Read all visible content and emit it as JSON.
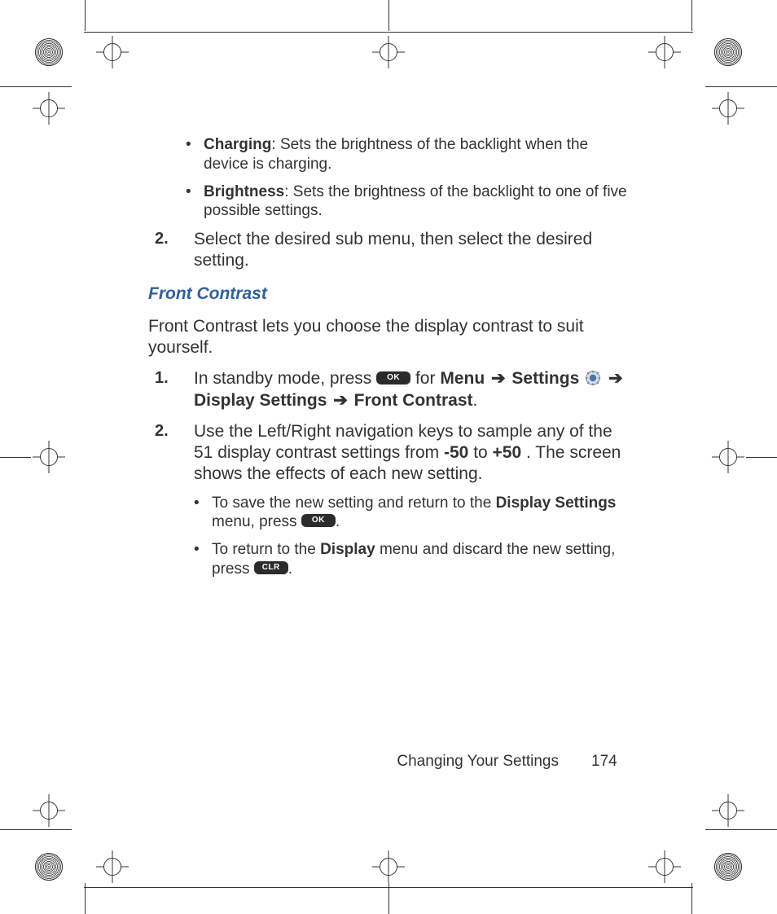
{
  "bullets_top": [
    {
      "term": "Charging",
      "desc": ": Sets the brightness of the backlight when the device is charging."
    },
    {
      "term": "Brightness",
      "desc": ": Sets the brightness of the backlight to one of five possible settings."
    }
  ],
  "step_top": {
    "num": "2.",
    "text": "Select the desired sub menu, then select the desired setting."
  },
  "heading": "Front Contrast",
  "intro": "Front Contrast lets you choose the display contrast to suit yourself.",
  "step1": {
    "num": "1.",
    "lead": "In standby mode, press ",
    "for": " for ",
    "menu": "Menu",
    "arrow": " ➔ ",
    "settings": "Settings",
    "arrow2": " ➔ ",
    "display_settings": "Display Settings",
    "arrow3": " ➔ ",
    "front_contrast": "Front Contrast",
    "period": "."
  },
  "step2": {
    "num": "2.",
    "pre": "Use the Left/Right navigation keys to sample any of the 51 display contrast settings from ",
    "min": "-50",
    "mid": " to ",
    "max": "+50",
    "post": ". The screen shows the effects of each new setting."
  },
  "sub_bullets": [
    {
      "pre": "To save the new setting and return to the ",
      "bold": "Display Settings",
      "mid": " menu, press ",
      "post": "."
    },
    {
      "pre": "To return to the ",
      "bold": "Display",
      "mid": " menu and discard the new setting, press ",
      "post": "."
    }
  ],
  "keys": {
    "ok": "OK",
    "clr": "CLR"
  },
  "footer": {
    "section": "Changing Your Settings",
    "page": "174"
  }
}
